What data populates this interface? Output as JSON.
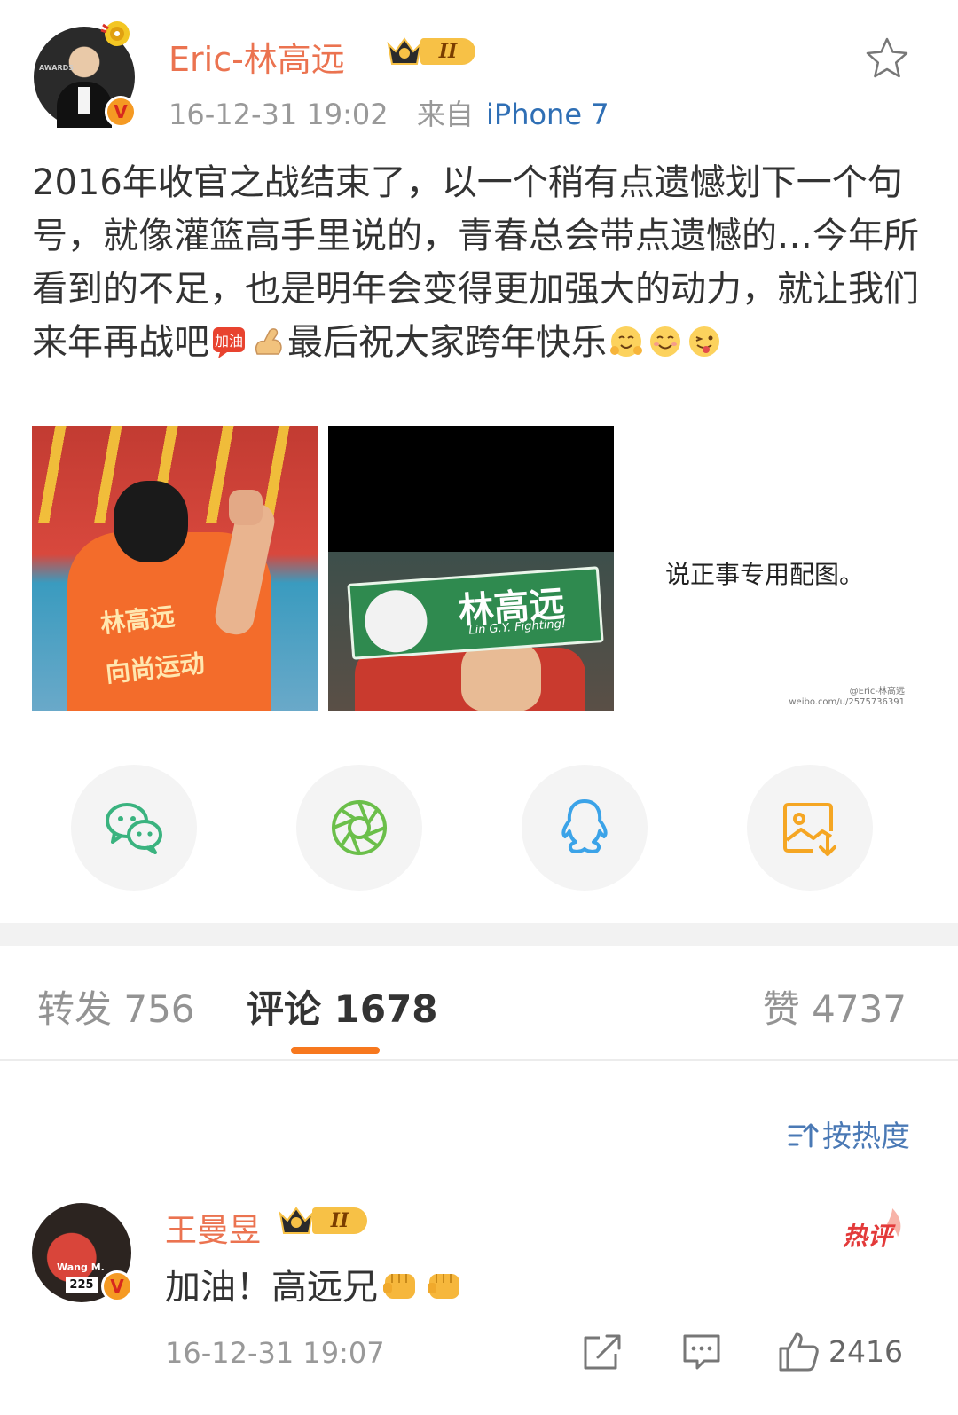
{
  "post": {
    "author": "Eric-林高远",
    "vip_level": "II",
    "timestamp": "16-12-31 19:02",
    "source_prefix": "来自",
    "source": "iPhone 7",
    "text_part1": "2016年收官之战结束了，以一个稍有点遗憾划下一个句号，就像灌篮高手里说的，青春总会带点遗憾的…今年所看到的不足，也是明年会变得更加强大的动力，就让我们来年再战吧",
    "text_part2": "最后祝大家跨年快乐",
    "inline_emoji_1": "加油",
    "avatar_board_text": "AWARDS",
    "verified_mark": "V",
    "images": {
      "jersey_name": "林高远",
      "jersey_slogan": "向尚运动",
      "sign_main": "林高远",
      "sign_sub": "Lin G.Y. Fighting!",
      "caption": "说正事专用配图。",
      "watermark_line1": "@Eric-林高远",
      "watermark_line2": "weibo.com/u/2575736391"
    }
  },
  "share": {
    "wechat": "wechat-icon",
    "moments": "moments-icon",
    "qq": "qq-icon",
    "save": "save-image-icon"
  },
  "tabs": {
    "repost": "转发 756",
    "comment": "评论 1678",
    "like": "赞 4737"
  },
  "sort_label": "按热度",
  "comment": {
    "author": "王曼昱",
    "vip_level": "II",
    "hot_label": "热评",
    "text": "加油！高远兄",
    "timestamp": "16-12-31 19:07",
    "likes": "2416",
    "avatar_number": "225",
    "avatar_name": "Wang M.",
    "verified_mark": "V"
  },
  "colors": {
    "name_orange": "#eb7350",
    "link_blue": "#2f6fb5",
    "tab_underline": "#f7781e",
    "wechat_green": "#3ab37f",
    "moments_green": "#6bbf4a",
    "qq_blue": "#3ba3e8",
    "save_orange": "#f5a623"
  }
}
